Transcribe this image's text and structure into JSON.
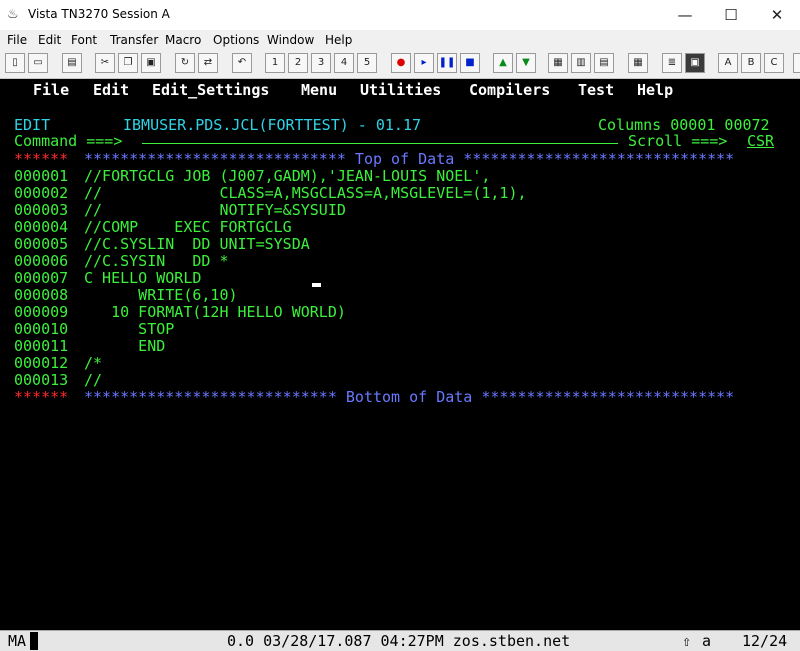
{
  "window": {
    "title": "Vista TN3270 Session A",
    "min": "—",
    "max": "☐",
    "close": "✕"
  },
  "menubar": [
    "File",
    "Edit",
    "Font",
    "Transfer",
    "Macro",
    "Options",
    "Window",
    "Help"
  ],
  "toolbar": {
    "buttons": [
      "1",
      "2",
      "3",
      "4",
      "5",
      "A",
      "B",
      "C"
    ]
  },
  "ispf": {
    "menu": [
      "File",
      "Edit",
      "Edit_Settings",
      "Menu",
      "Utilities",
      "Compilers",
      "Test",
      "Help"
    ],
    "mode": "EDIT",
    "dataset": "IBMUSER.PDS.JCL(FORTTEST) - 01.17",
    "columns": "Columns 00001 00072",
    "command_label": "Command ===>",
    "command_value": "",
    "scroll_label": "Scroll ===>",
    "scroll_value": "CSR",
    "top_marker": "******",
    "top_text": "***************************** Top of Data ******************************",
    "bottom_marker": "******",
    "bottom_text": "**************************** Bottom of Data ****************************",
    "lines": [
      {
        "num": "000001",
        "text": "//FORTGCLG JOB (J007,GADM),'JEAN-LOUIS NOEL',"
      },
      {
        "num": "000002",
        "text": "//             CLASS=A,MSGCLASS=A,MSGLEVEL=(1,1),"
      },
      {
        "num": "000003",
        "text": "//             NOTIFY=&SYSUID"
      },
      {
        "num": "000004",
        "text": "//COMP    EXEC FORTGCLG"
      },
      {
        "num": "000005",
        "text": "//C.SYSLIN  DD UNIT=SYSDA"
      },
      {
        "num": "000006",
        "text": "//C.SYSIN   DD *"
      },
      {
        "num": "000007",
        "text": "C HELLO WORLD"
      },
      {
        "num": "000008",
        "text": "      WRITE(6,10)"
      },
      {
        "num": "000009",
        "text": "   10 FORMAT(12H HELLO WORLD)"
      },
      {
        "num": "000010",
        "text": "      STOP"
      },
      {
        "num": "000011",
        "text": "      END"
      },
      {
        "num": "000012",
        "text": "/*"
      },
      {
        "num": "000013",
        "text": "//"
      }
    ]
  },
  "statusbar": {
    "left": "MA",
    "center": "0.0 03/28/17.087 04:27PM zos.stben.net",
    "mode": "a",
    "position": "12/24"
  }
}
